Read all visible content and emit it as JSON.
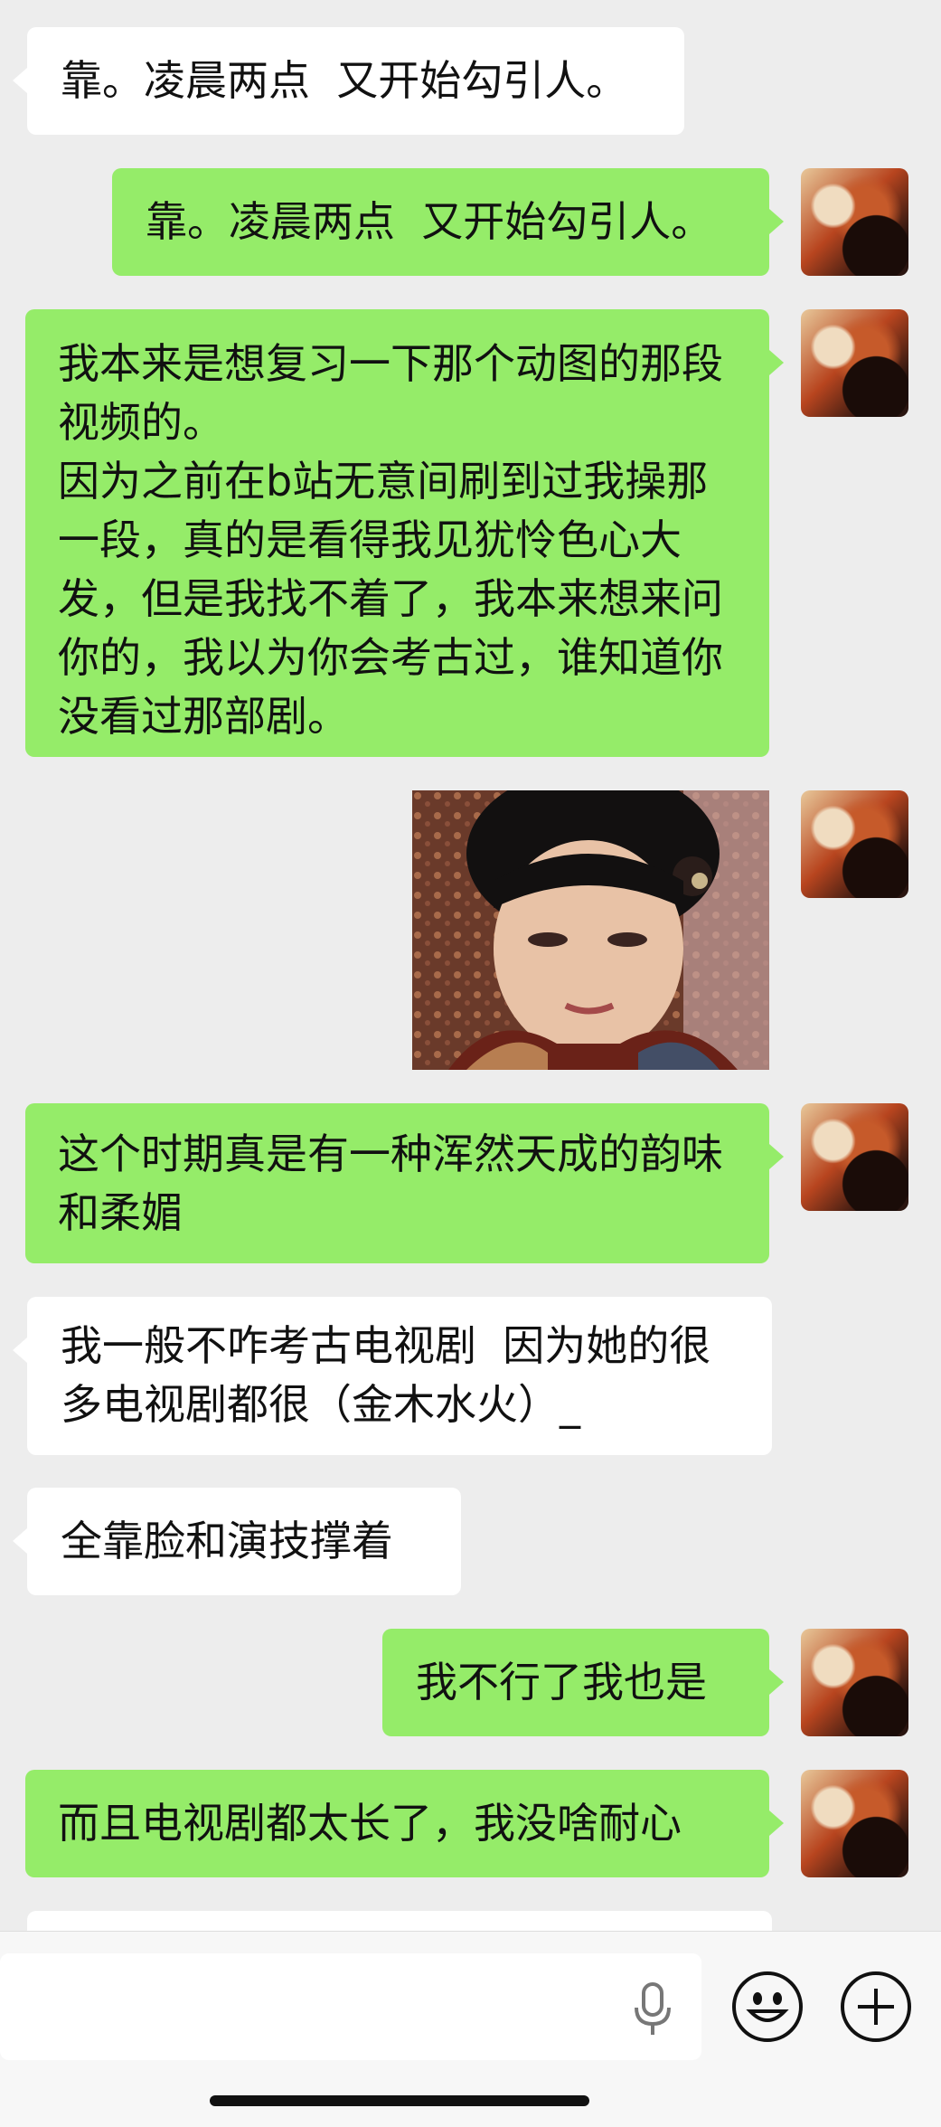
{
  "messages": [
    {
      "dir": "in",
      "text": "靠。凌晨两点  又开始勾引人。"
    },
    {
      "dir": "out",
      "text": "靠。凌晨两点  又开始勾引人。"
    },
    {
      "dir": "out",
      "text": "我本来是想复习一下那个动图的那段视频的。\n因为之前在b站无意间刷到过我操那一段，真的是看得我见犹怜色心大发，但是我找不着了，我本来想来问你的，我以为你会考古过，谁知道你没看过那部剧。"
    },
    {
      "dir": "out",
      "type": "image"
    },
    {
      "dir": "out",
      "text": "这个时期真是有一种浑然天成的韵味和柔媚"
    },
    {
      "dir": "in",
      "text": "我一般不咋考古电视剧  因为她的很多电视剧都很（金木水火）_"
    },
    {
      "dir": "in",
      "text": "全靠脸和演技撑着"
    },
    {
      "dir": "out",
      "text": "我不行了我也是"
    },
    {
      "dir": "out",
      "text": "而且电视剧都太长了，我没啥耐心"
    }
  ],
  "input": {
    "value": ""
  },
  "icons": {
    "voice": "microphone-icon",
    "emoji": "emoji-icon",
    "more": "plus-icon"
  },
  "colors": {
    "background": "#ededed",
    "incoming": "#ffffff",
    "outgoing": "#95ec69"
  }
}
